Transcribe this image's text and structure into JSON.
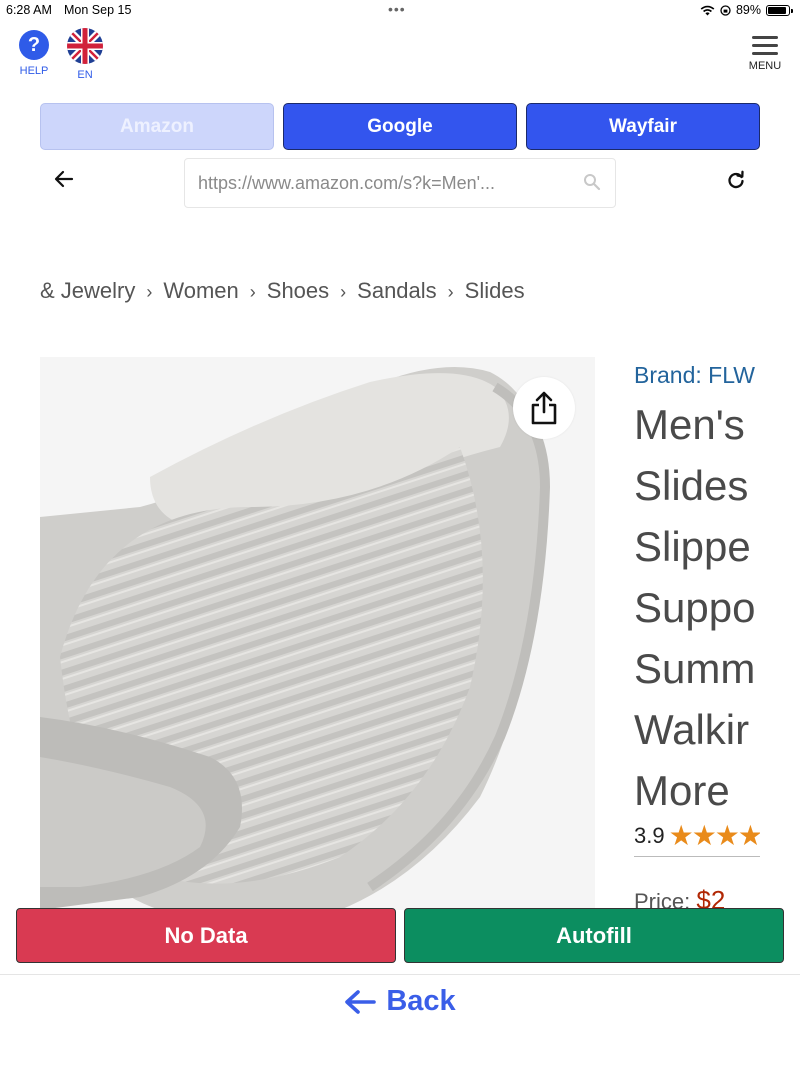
{
  "status_bar": {
    "time": "6:28 AM",
    "date": "Mon Sep 15",
    "battery": "89%"
  },
  "top_bar": {
    "help_label": "HELP",
    "language_label": "EN",
    "menu_label": "MENU"
  },
  "engines": [
    {
      "label": "Amazon",
      "disabled": true
    },
    {
      "label": "Google",
      "disabled": false
    },
    {
      "label": "Wayfair",
      "disabled": false
    }
  ],
  "url_bar": {
    "value": "https://www.amazon.com/s?k=Men'..."
  },
  "page": {
    "breadcrumb": [
      "& Jewelry",
      "Women",
      "Shoes",
      "Sandals",
      "Slides"
    ],
    "brand": "Brand: FLW",
    "title_lines": [
      "Men's",
      "Slides",
      "Slippe",
      "Suppo",
      "Summ",
      "Walkir",
      "More"
    ],
    "rating": "3.9",
    "price_label": "Price:",
    "price_value": "$2"
  },
  "actions": {
    "no_data": "No Data",
    "autofill": "Autofill"
  },
  "bottom": {
    "back_label": "Back"
  },
  "colors": {
    "primary_blue": "#3355ee",
    "disabled_blue": "#cdd6fb",
    "no_data_red": "#d93a52",
    "autofill_green": "#0c8e60",
    "back_blue": "#3a5ee8"
  }
}
